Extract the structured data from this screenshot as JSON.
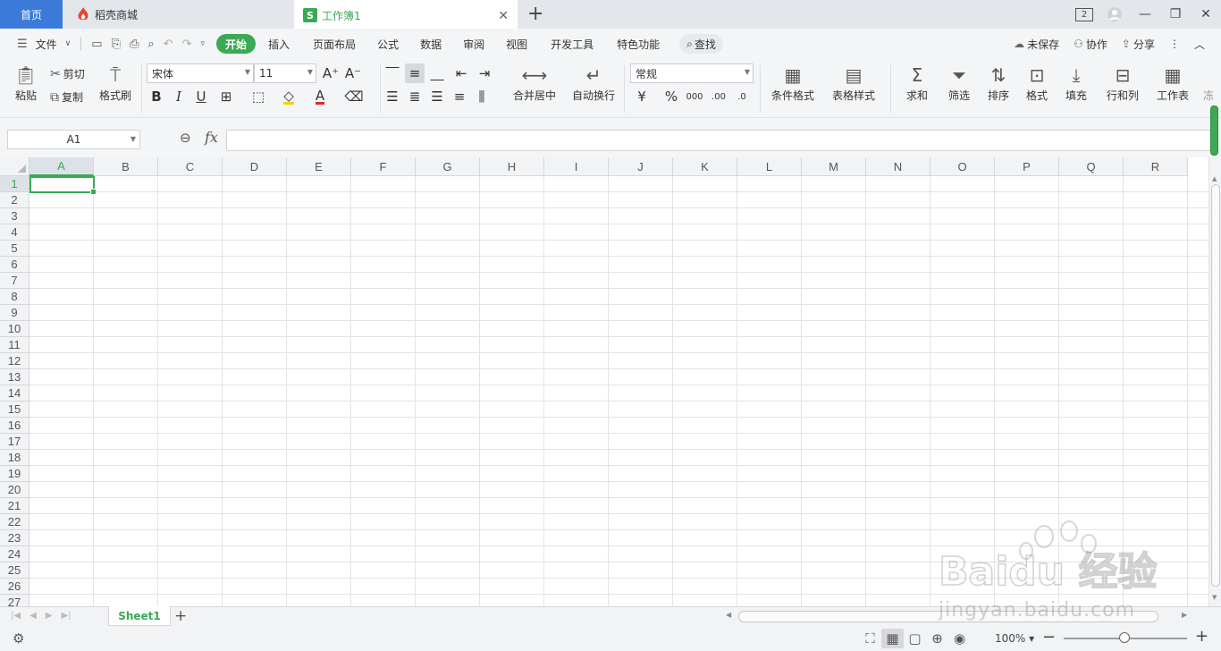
{
  "tabs": {
    "home": "首页",
    "store": "稻壳商城",
    "workbook": "工作簿1",
    "workbook_icon": "S",
    "new_tab": "+",
    "close": "✕"
  },
  "window": {
    "badge": "2"
  },
  "menu": {
    "file": "文件",
    "items": [
      "开始",
      "插入",
      "页面布局",
      "公式",
      "数据",
      "审阅",
      "视图",
      "开发工具",
      "特色功能"
    ],
    "search": "查找",
    "unsaved": "未保存",
    "collab": "协作",
    "share": "分享"
  },
  "ribbon": {
    "paste": "粘贴",
    "cut": "剪切",
    "copy": "复制",
    "format_painter": "格式刷",
    "font_name": "宋体",
    "font_size": "11",
    "merge_center": "合并居中",
    "wrap_text": "自动换行",
    "number_format": "常规",
    "conditional_format": "条件格式",
    "table_style": "表格样式",
    "sum": "求和",
    "filter": "筛选",
    "sort": "排序",
    "format": "格式",
    "fill": "填充",
    "row_col": "行和列",
    "worksheet": "工作表",
    "more": "冻"
  },
  "formula_bar": {
    "name_box": "A1",
    "fx": "fx",
    "value": ""
  },
  "grid": {
    "columns": [
      "A",
      "B",
      "C",
      "D",
      "E",
      "F",
      "G",
      "H",
      "I",
      "J",
      "K",
      "L",
      "M",
      "N",
      "O",
      "P",
      "Q",
      "R"
    ],
    "rows": [
      "1",
      "2",
      "3",
      "4",
      "5",
      "6",
      "7",
      "8",
      "9",
      "10",
      "11",
      "12",
      "13",
      "14",
      "15",
      "16",
      "17",
      "18",
      "19",
      "20",
      "21",
      "22",
      "23",
      "24",
      "25",
      "26",
      "27"
    ],
    "selected_cell": "A1"
  },
  "sheets": {
    "tabs": [
      "Sheet1"
    ],
    "add": "+"
  },
  "status": {
    "zoom": "100%"
  },
  "watermark": {
    "text": "jingyan.baidu.com",
    "brand": "Baidu 经验"
  },
  "colors": {
    "accent": "#3aaa55",
    "home_tab": "#3b7ad9"
  }
}
